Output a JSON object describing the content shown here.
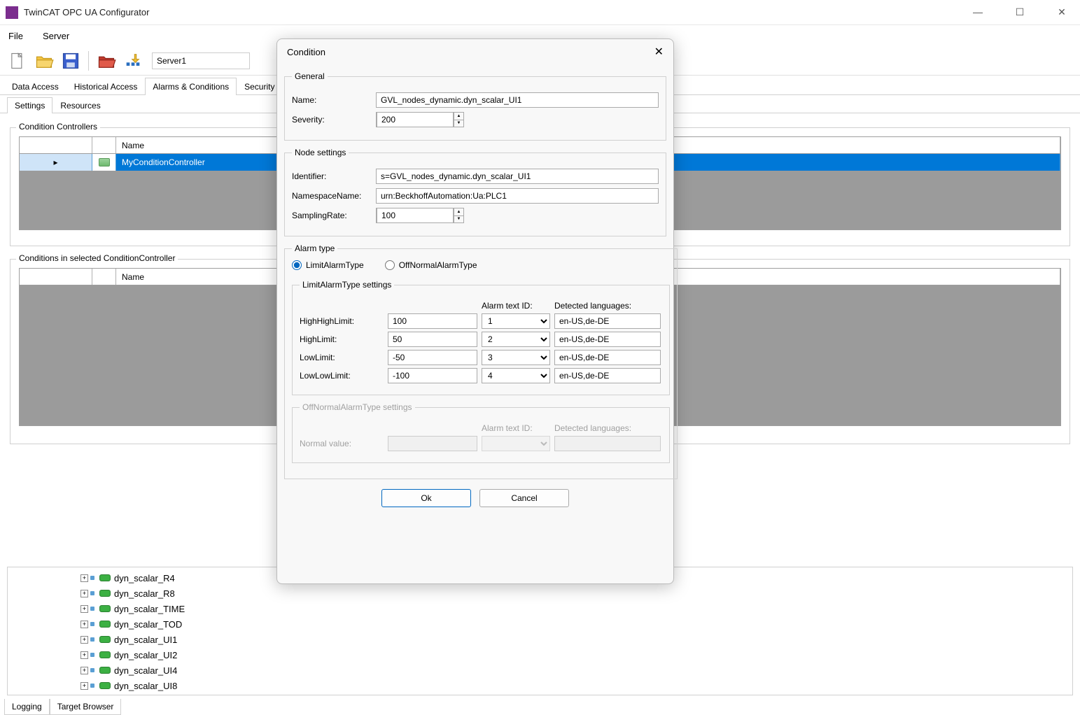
{
  "window": {
    "title": "TwinCAT OPC UA Configurator"
  },
  "menu": [
    "File",
    "Server"
  ],
  "toolbar": {
    "server_selected": "Server1"
  },
  "tabs": {
    "main": [
      "Data Access",
      "Historical Access",
      "Alarms & Conditions",
      "Security"
    ],
    "active_main": "Alarms & Conditions",
    "sub": [
      "Settings",
      "Resources"
    ],
    "active_sub": "Settings"
  },
  "groups": {
    "controllers": {
      "legend": "Condition Controllers",
      "columns": [
        "",
        "",
        "Name"
      ],
      "rows": [
        {
          "name": "MyConditionController"
        }
      ]
    },
    "conditions": {
      "legend": "Conditions in selected ConditionController",
      "columns": [
        "",
        "",
        "Name"
      ]
    }
  },
  "tree": {
    "nodes": [
      "dyn_scalar_R4",
      "dyn_scalar_R8",
      "dyn_scalar_TIME",
      "dyn_scalar_TOD",
      "dyn_scalar_UI1",
      "dyn_scalar_UI2",
      "dyn_scalar_UI4",
      "dyn_scalar_UI8"
    ]
  },
  "bottom_tabs": [
    "Logging",
    "Target Browser"
  ],
  "bottom_active": "Target Browser",
  "dialog": {
    "title": "Condition",
    "general": {
      "legend": "General",
      "name_label": "Name:",
      "name_value": "GVL_nodes_dynamic.dyn_scalar_UI1",
      "severity_label": "Severity:",
      "severity_value": "200"
    },
    "node": {
      "legend": "Node settings",
      "identifier_label": "Identifier:",
      "identifier_value": "s=GVL_nodes_dynamic.dyn_scalar_UI1",
      "ns_label": "NamespaceName:",
      "ns_value": "urn:BeckhoffAutomation:Ua:PLC1",
      "sampling_label": "SamplingRate:",
      "sampling_value": "100"
    },
    "alarm": {
      "legend": "Alarm type",
      "limit_label": "LimitAlarmType",
      "offnormal_label": "OffNormalAlarmType",
      "selected": "limit"
    },
    "limit_settings": {
      "legend": "LimitAlarmType settings",
      "header_id": "Alarm text ID:",
      "header_langs": "Detected languages:",
      "rows": [
        {
          "label": "HighHighLimit:",
          "value": "100",
          "id": "1",
          "langs": "en-US,de-DE"
        },
        {
          "label": "HighLimit:",
          "value": "50",
          "id": "2",
          "langs": "en-US,de-DE"
        },
        {
          "label": "LowLimit:",
          "value": "-50",
          "id": "3",
          "langs": "en-US,de-DE"
        },
        {
          "label": "LowLowLimit:",
          "value": "-100",
          "id": "4",
          "langs": "en-US,de-DE"
        }
      ]
    },
    "offnormal_settings": {
      "legend": "OffNormalAlarmType settings",
      "header_id": "Alarm text ID:",
      "header_langs": "Detected languages:",
      "normal_label": "Normal value:"
    },
    "buttons": {
      "ok": "Ok",
      "cancel": "Cancel"
    }
  }
}
